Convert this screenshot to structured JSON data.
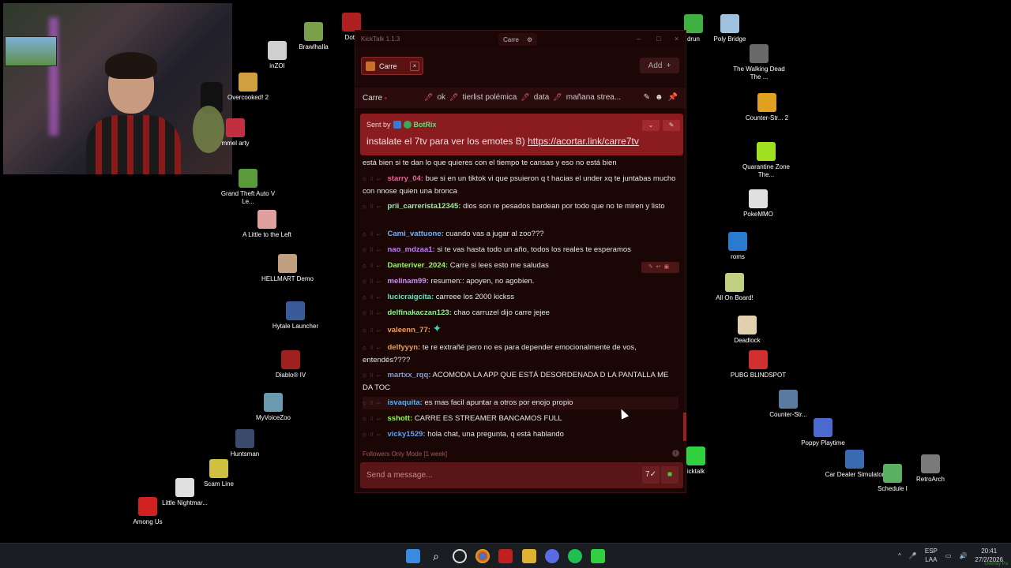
{
  "desktop_icons": [
    {
      "label": "BrawlhaIla",
      "color": "#7aa04a"
    },
    {
      "label": "Dota",
      "color": "#b02020"
    },
    {
      "label": "inZOI",
      "color": "#d0d0d0"
    },
    {
      "label": "Overcooked! 2",
      "color": "#d0a040"
    },
    {
      "label": "mmel arty",
      "color": "#c03040"
    },
    {
      "label": "Grand Theft Auto V Le...",
      "color": "#5a9a3a"
    },
    {
      "label": "A Little to the Left",
      "color": "#e0a0a0"
    },
    {
      "label": "HELLMART Demo",
      "color": "#c0a080"
    },
    {
      "label": "Hytale Launcher",
      "color": "#3a5a9a"
    },
    {
      "label": "Diablo® IV",
      "color": "#a02020"
    },
    {
      "label": "MyVoiceZoo",
      "color": "#6a9ab0"
    },
    {
      "label": "Huntsman",
      "color": "#3a4a6a"
    },
    {
      "label": "Scam Line",
      "color": "#d0c040"
    },
    {
      "label": "Little Nightmar...",
      "color": "#e0e0e0"
    },
    {
      "label": "Among Us",
      "color": "#d02020"
    },
    {
      "label": "drun",
      "color": "#40b040"
    },
    {
      "label": "Poly Bridge",
      "color": "#a0c0e0"
    },
    {
      "label": "The Walking Dead The ...",
      "color": "#6a6a6a"
    },
    {
      "label": "Counter-Str... 2",
      "color": "#e0a020"
    },
    {
      "label": "Quarantine Zone The...",
      "color": "#a0e020"
    },
    {
      "label": "PokeMMO",
      "color": "#e0e0e0"
    },
    {
      "label": "roms",
      "color": "#2a7ad0"
    },
    {
      "label": "All On Board!",
      "color": "#c0d080"
    },
    {
      "label": "Deadlock",
      "color": "#e0d0b0"
    },
    {
      "label": "PUBG BLINDSPOT",
      "color": "#d03030"
    },
    {
      "label": "Counter-Str...",
      "color": "#5a7aa0"
    },
    {
      "label": "Poppy Playtime",
      "color": "#4a6ad0"
    },
    {
      "label": "icktalk",
      "color": "#30d040"
    },
    {
      "label": "Car Dealer Simulator",
      "color": "#3a6ab0"
    },
    {
      "label": "Schedule I",
      "color": "#5ab060"
    },
    {
      "label": "RetroArch",
      "color": "#7a7a7a"
    }
  ],
  "window": {
    "title": "KickTalk 1.1.3",
    "channel_pill": "Carre",
    "settings_icon": "gear-icon",
    "minimize": "–",
    "maximize": "□",
    "close": "×"
  },
  "tabs": [
    {
      "label": "Carre",
      "close": "×"
    }
  ],
  "add_button": {
    "label": "Add",
    "icon": "+"
  },
  "channel_bar": {
    "name": "Carre",
    "pinned_topics": [
      "ok",
      "tierlist polémica",
      "data",
      "mañana strea..."
    ]
  },
  "pinned_message": {
    "sent_by_label": "Sent by",
    "bot_name": "BotRix",
    "text": "instalate el 7tv para ver los emotes B)",
    "link": "https://acortar.link/carre7tv"
  },
  "messages": [
    {
      "user": "",
      "text": "está bien si te dan lo que quieres con el tiempo te cansas y eso no está bien",
      "color": "#e6e6e6"
    },
    {
      "user": "starry_04:",
      "text": "bue si en un tiktok vi que psuieron q t hacias el under xq te juntabas mucho con nnose quien una bronca",
      "color": "#e06a9a"
    },
    {
      "user": "prii_carrerista12345:",
      "text": "dios son re pesados bardean por todo que no te miren y listo",
      "color": "#9af0a0"
    },
    {
      "user": "Cami_vattuone:",
      "text": "cuando vas a jugar al zoo???",
      "color": "#7ab0f0"
    },
    {
      "user": "nao_mdzaa1:",
      "text": "si te vas hasta todo un año, todos los reales te esperamos",
      "color": "#c080f0"
    },
    {
      "user": "Danteriver_2024:",
      "text": "Carre si lees esto me saludas",
      "color": "#a0f070"
    },
    {
      "user": "melinam99:",
      "text": "resumen:: apoyen, no agobien.",
      "color": "#d090f0"
    },
    {
      "user": "lucicraigcita:",
      "text": "carreee los 2000 kickss",
      "color": "#70e0c0"
    },
    {
      "user": "delfinakaczan123:",
      "text": "chao carruzel dijo carre jejee",
      "color": "#90f090"
    },
    {
      "user": "valeenn_77:",
      "text": "",
      "color": "#f0a060"
    },
    {
      "user": "delfyyyn:",
      "text": "te re extrañé pero no es para depender emocionalmente de vos, entendés????",
      "color": "#e0a060"
    },
    {
      "user": "martxx_rqq:",
      "text": "ACOMODA LA APP QUE ESTÁ DESORDENADA D LA PANTALLA ME DA TOC",
      "color": "#7aa0e0"
    },
    {
      "user": "isvaquita:",
      "text": "es mas facil apuntar a otros por enojo propio",
      "color": "#5ab0f0"
    },
    {
      "user": "sshott:",
      "text": "CARRE ES STREAMER BANCAMOS FULL",
      "color": "#a0f060"
    },
    {
      "user": "vicky1529:",
      "text": "hola chat, una pregunta, q está hablando",
      "color": "#60a0f0"
    }
  ],
  "followers_mode": "Followers Only Mode [1 week]",
  "input": {
    "placeholder": "Send a message..."
  },
  "taskbar": {
    "lang": "ESP",
    "lang_sub": "LAA",
    "time": "20:41",
    "date": "27/2/2026",
    "watermark": "Overlay Pa"
  }
}
